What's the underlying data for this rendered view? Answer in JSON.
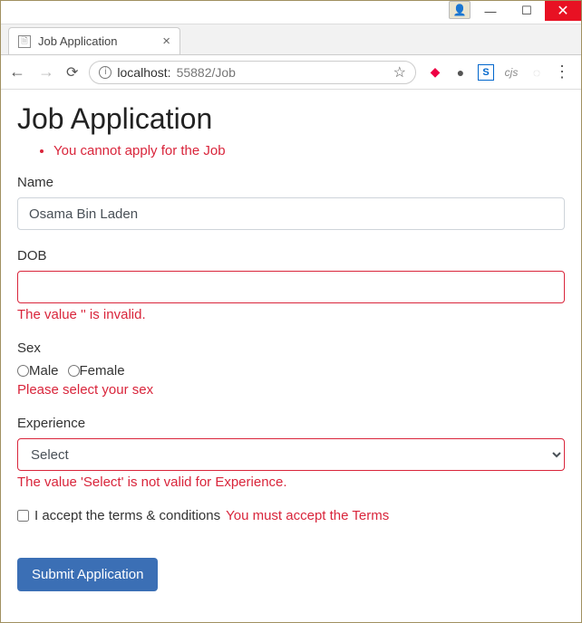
{
  "window": {
    "tab_title": "Job Application",
    "url_host": "localhost:",
    "url_port_path": "55882/Job"
  },
  "page": {
    "heading": "Job Application",
    "summary_errors": [
      "You cannot apply for the Job"
    ],
    "fields": {
      "name": {
        "label": "Name",
        "value": "Osama Bin Laden",
        "error": ""
      },
      "dob": {
        "label": "DOB",
        "value": "",
        "error": "The value '' is invalid."
      },
      "sex": {
        "label": "Sex",
        "options": {
          "male": "Male",
          "female": "Female"
        },
        "selected": "",
        "error": "Please select your sex"
      },
      "experience": {
        "label": "Experience",
        "selected": "Select",
        "error": "The value 'Select' is not valid for Experience."
      },
      "terms": {
        "label": "I accept the terms & conditions",
        "checked": false,
        "error": "You must accept the Terms"
      }
    },
    "submit_label": "Submit Application"
  }
}
